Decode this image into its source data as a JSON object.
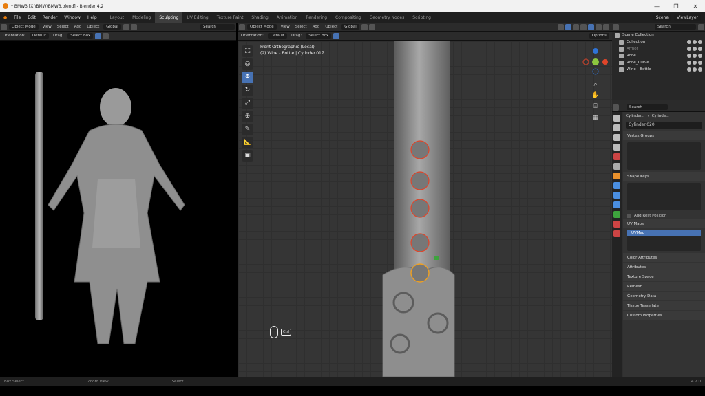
{
  "window": {
    "title": "* BMW3 [X:\\BMW\\BMW3.blend] - Blender 4.2",
    "controls": [
      "—",
      "❐",
      "✕"
    ]
  },
  "menus": [
    "File",
    "Edit",
    "Render",
    "Window",
    "Help"
  ],
  "workspaces": [
    "Layout",
    "Modeling",
    "Sculpting",
    "UV Editing",
    "Texture Paint",
    "Shading",
    "Animation",
    "Rendering",
    "Compositing",
    "Geometry Nodes",
    "Scripting"
  ],
  "active_workspace": "Sculpting",
  "scene": {
    "scene_label": "Scene",
    "viewlayer_label": "ViewLayer"
  },
  "left_header": {
    "mode": "Object Mode",
    "menus": [
      "View",
      "Select",
      "Add",
      "Object"
    ],
    "transform": "Global",
    "search_placeholder": "Search"
  },
  "left_tool_header": {
    "orientation_label": "Orientation:",
    "orientation_value": "Default",
    "drag_label": "Drag:",
    "drag_value": "Select Box"
  },
  "main_header": {
    "mode": "Object Mode",
    "menus": [
      "View",
      "Select",
      "Add",
      "Object"
    ],
    "transform": "Global"
  },
  "main_tool_header": {
    "orientation_label": "Orientation:",
    "orientation_value": "Default",
    "drag_label": "Drag:",
    "drag_value": "Select Box",
    "options_label": "Options"
  },
  "viewport": {
    "view_name": "Front Orthographic (Local)",
    "object_info": "(2) Wine - Bottle | Cylinder.017",
    "ctrl_label": "Ctrl"
  },
  "outliner": {
    "search_placeholder": "Search",
    "root": "Scene Collection",
    "rows": [
      "Collection",
      "Armor",
      "Robe",
      "Robe_Curve",
      "Wine - Bottle"
    ]
  },
  "properties": {
    "search_placeholder": "Search",
    "breadcrumb_1": "Cylinder...",
    "breadcrumb_2": "Cylinde...",
    "mesh_name": "Cylinder.020",
    "sections": {
      "vertex_groups": "Vertex Groups",
      "shape_keys": "Shape Keys",
      "add_rest_position": "Add Rest Position",
      "uv_maps": "UV Maps",
      "uv_map_item": "UVMap"
    },
    "collapsed": [
      "Color Attributes",
      "Attributes",
      "Texture Space",
      "Remesh",
      "Geometry Data",
      "Tissue Tessellate",
      "Custom Properties"
    ]
  },
  "status": {
    "left": "Box Select",
    "middle": "Zoom View",
    "right": "Select",
    "version": "4.2.0"
  },
  "colors": {
    "accent": "#4772b3",
    "active_ws": "#3d3d3d",
    "sculpt_red": "#e0452a"
  }
}
